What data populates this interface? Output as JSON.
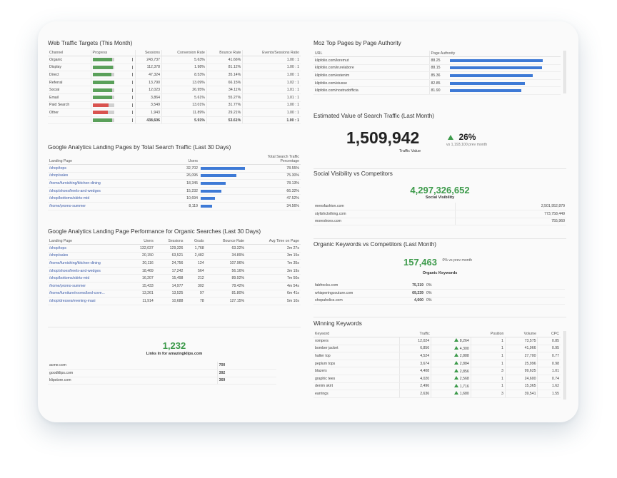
{
  "traffic": {
    "title": "Web Traffic Targets (This Month)",
    "headers": [
      "Channel",
      "Progress",
      "Sessions",
      "Conversion Rate",
      "Bounce Rate",
      "Events/Sessions Ratio"
    ],
    "rows": [
      {
        "channel": "Organic",
        "sessions": "243,737",
        "conv": "5.63%",
        "bounce": "41.66%",
        "events": "1.00 : 1",
        "progress": 0.92,
        "color": "#5aa05a"
      },
      {
        "channel": "Display",
        "sessions": "112,378",
        "conv": "1.98%",
        "bounce": "81.12%",
        "events": "1.00 : 1",
        "progress": 0.95,
        "color": "#5aa05a"
      },
      {
        "channel": "Direct",
        "sessions": "47,324",
        "conv": "8.53%",
        "bounce": "35.14%",
        "events": "1.00 : 1",
        "progress": 0.88,
        "color": "#5aa05a"
      },
      {
        "channel": "Referral",
        "sessions": "13,790",
        "conv": "13.09%",
        "bounce": "66.15%",
        "events": "1.02 : 1",
        "progress": 1.0,
        "color": "#5aa05a"
      },
      {
        "channel": "Social",
        "sessions": "12,023",
        "conv": "26.95%",
        "bounce": "34.11%",
        "events": "1.01 : 1",
        "progress": 0.9,
        "color": "#5aa05a"
      },
      {
        "channel": "Email",
        "sessions": "3,864",
        "conv": "5.61%",
        "bounce": "55.27%",
        "events": "1.01 : 1",
        "progress": 0.93,
        "color": "#5aa05a"
      },
      {
        "channel": "Paid Search",
        "sessions": "3,549",
        "conv": "13.01%",
        "bounce": "31.77%",
        "events": "1.00 : 1",
        "progress": 0.75,
        "color": "#d9534f"
      },
      {
        "channel": "Other",
        "sessions": "1,943",
        "conv": "11.89%",
        "bounce": "29.21%",
        "events": "1.00 : 1",
        "progress": 0.72,
        "color": "#d9534f"
      }
    ],
    "total": {
      "sessions": "438,606",
      "conv": "5.91%",
      "bounce": "53.61%",
      "events": "1.00 : 1",
      "progress": 0.9,
      "color": "#5aa05a"
    }
  },
  "landing": {
    "title": "Google Analytics Landing Pages by Total Search Traffic (Last 30 Days)",
    "headers": [
      "Landing Page",
      "Users",
      "Total Search Traffic Percentage"
    ],
    "rows": [
      {
        "page": "/shop/tops",
        "users": "32,702",
        "pct": "78.55%",
        "share": 1.0
      },
      {
        "page": "/shop/sales",
        "users": "26,095",
        "pct": "75.30%",
        "share": 0.8
      },
      {
        "page": "/home/furnishing/kitchen-dining",
        "users": "18,345",
        "pct": "78.13%",
        "share": 0.56
      },
      {
        "page": "/shop/shoes/heels-and-wedges",
        "users": "15,232",
        "pct": "66.32%",
        "share": 0.47
      },
      {
        "page": "/shop/bottoms/skirts-mid",
        "users": "10,694",
        "pct": "47.52%",
        "share": 0.33
      },
      {
        "page": "/home/promo-summer",
        "users": "8,119",
        "pct": "34.56%",
        "share": 0.25
      }
    ]
  },
  "organic": {
    "title": "Google Analytics Landing Page Performance for Organic Searches (Last 30 Days)",
    "headers": [
      "Landing Page",
      "Users",
      "Sessions",
      "Goals",
      "Bounce Rate",
      "Avg Time on Page"
    ],
    "rows": [
      {
        "page": "/shop/tops",
        "users": "132,037",
        "sessions": "129,326",
        "goals": "1,768",
        "bounce": "63.32%",
        "time": "2m 27s"
      },
      {
        "page": "/shop/sales",
        "users": "20,150",
        "sessions": "63,521",
        "goals": "2,482",
        "bounce": "34.89%",
        "time": "3m 15s"
      },
      {
        "page": "/home/furnishing/kitchen-dining",
        "users": "20,116",
        "sessions": "24,756",
        "goals": "124",
        "bounce": "107.96%",
        "time": "7m 35s"
      },
      {
        "page": "/shop/shoes/heels-and-wedges",
        "users": "18,469",
        "sessions": "17,242",
        "goals": "564",
        "bounce": "56.16%",
        "time": "3m 19s"
      },
      {
        "page": "/shop/bottoms/skirts-mid",
        "users": "16,207",
        "sessions": "15,498",
        "goals": "212",
        "bounce": "89.92%",
        "time": "7m 50s"
      },
      {
        "page": "/home/promo-summer",
        "users": "15,433",
        "sessions": "14,977",
        "goals": "302",
        "bounce": "78.42%",
        "time": "4m 54s"
      },
      {
        "page": "/home/furniture/rooms/bed-cove...",
        "users": "13,261",
        "sessions": "13,525",
        "goals": "97",
        "bounce": "81.80%",
        "time": "6m 41s"
      },
      {
        "page": "/shop/dresses/evening-maxi",
        "users": "11,914",
        "sessions": "10,688",
        "goals": "78",
        "bounce": "127.15%",
        "time": "5m 10s"
      }
    ]
  },
  "links": {
    "value": "1,232",
    "caption": "Links In for amazingklips.com",
    "rows": [
      {
        "site": "acme.com",
        "count": "700"
      },
      {
        "site": "goodklips.com",
        "count": "392"
      },
      {
        "site": "klipstore.com",
        "count": "369"
      }
    ]
  },
  "moz": {
    "title": "Moz Top Pages by Page Authority",
    "headers": [
      "URL",
      "Page Authority"
    ],
    "rows": [
      {
        "url": "klipfolio.com/loremut",
        "pa": "88.25"
      },
      {
        "url": "klipfolio.com/irurelabore",
        "pa": "88.15"
      },
      {
        "url": "klipfolio.com/estenim",
        "pa": "85.36"
      },
      {
        "url": "klipfolio.com/eiusse",
        "pa": "82.85"
      },
      {
        "url": "klipfolio.com/nostrudofficia",
        "pa": "81.90"
      }
    ]
  },
  "estimated": {
    "title": "Estimated Value of Search Traffic (Last Month)",
    "value": "1,509,942",
    "caption": "Traffic Value",
    "change": "26%",
    "prev": "vs 1,193,100 prev month"
  },
  "social": {
    "title": "Social Visibility vs Competitors",
    "value": "4,297,326,652",
    "caption": "Social Visibility",
    "rows": [
      {
        "site": "mensfashion.com",
        "value": "2,501,952,879"
      },
      {
        "site": "stylishclothing.com",
        "value": "773,758,449"
      },
      {
        "site": "moreshoes.com",
        "value": "755,960"
      }
    ]
  },
  "keywords": {
    "title": "Organic Keywords vs Competitors (Last Month)",
    "value": "157,463",
    "change": "0% vs prev month",
    "caption": "Organic Keywords",
    "rows": [
      {
        "site": "fabfrocks.com",
        "value": "75,319",
        "pct": "0%"
      },
      {
        "site": "whisperingcouture.com",
        "value": "69,239",
        "pct": "0%"
      },
      {
        "site": "shopaholics.com",
        "value": "4,600",
        "pct": "0%"
      }
    ]
  },
  "winning": {
    "title": "Winning Keywords",
    "headers": [
      "Keyword",
      "Traffic",
      "",
      "Position",
      "Volume",
      "CPC"
    ],
    "rows": [
      {
        "kw": "rompers",
        "traffic": "12,024",
        "change": "8,264",
        "pos": "1",
        "vol": "73,575",
        "cpc": "0.85"
      },
      {
        "kw": "bomber jacket",
        "traffic": "6,856",
        "change": "4,300",
        "pos": "1",
        "vol": "41,966",
        "cpc": "0.95"
      },
      {
        "kw": "halter top",
        "traffic": "4,524",
        "change": "2,888",
        "pos": "1",
        "vol": "27,700",
        "cpc": "0.77"
      },
      {
        "kw": "peplum tops",
        "traffic": "3,674",
        "change": "2,884",
        "pos": "1",
        "vol": "25,996",
        "cpc": "0.98"
      },
      {
        "kw": "blazers",
        "traffic": "4,408",
        "change": "2,856",
        "pos": "3",
        "vol": "99,625",
        "cpc": "1.01"
      },
      {
        "kw": "graphic tees",
        "traffic": "4,020",
        "change": "2,568",
        "pos": "1",
        "vol": "24,600",
        "cpc": "0.74"
      },
      {
        "kw": "denim skirt",
        "traffic": "2,496",
        "change": "1,716",
        "pos": "1",
        "vol": "15,365",
        "cpc": "1.62"
      },
      {
        "kw": "earrings",
        "traffic": "2,636",
        "change": "1,680",
        "pos": "3",
        "vol": "39,541",
        "cpc": "1.55"
      }
    ]
  }
}
